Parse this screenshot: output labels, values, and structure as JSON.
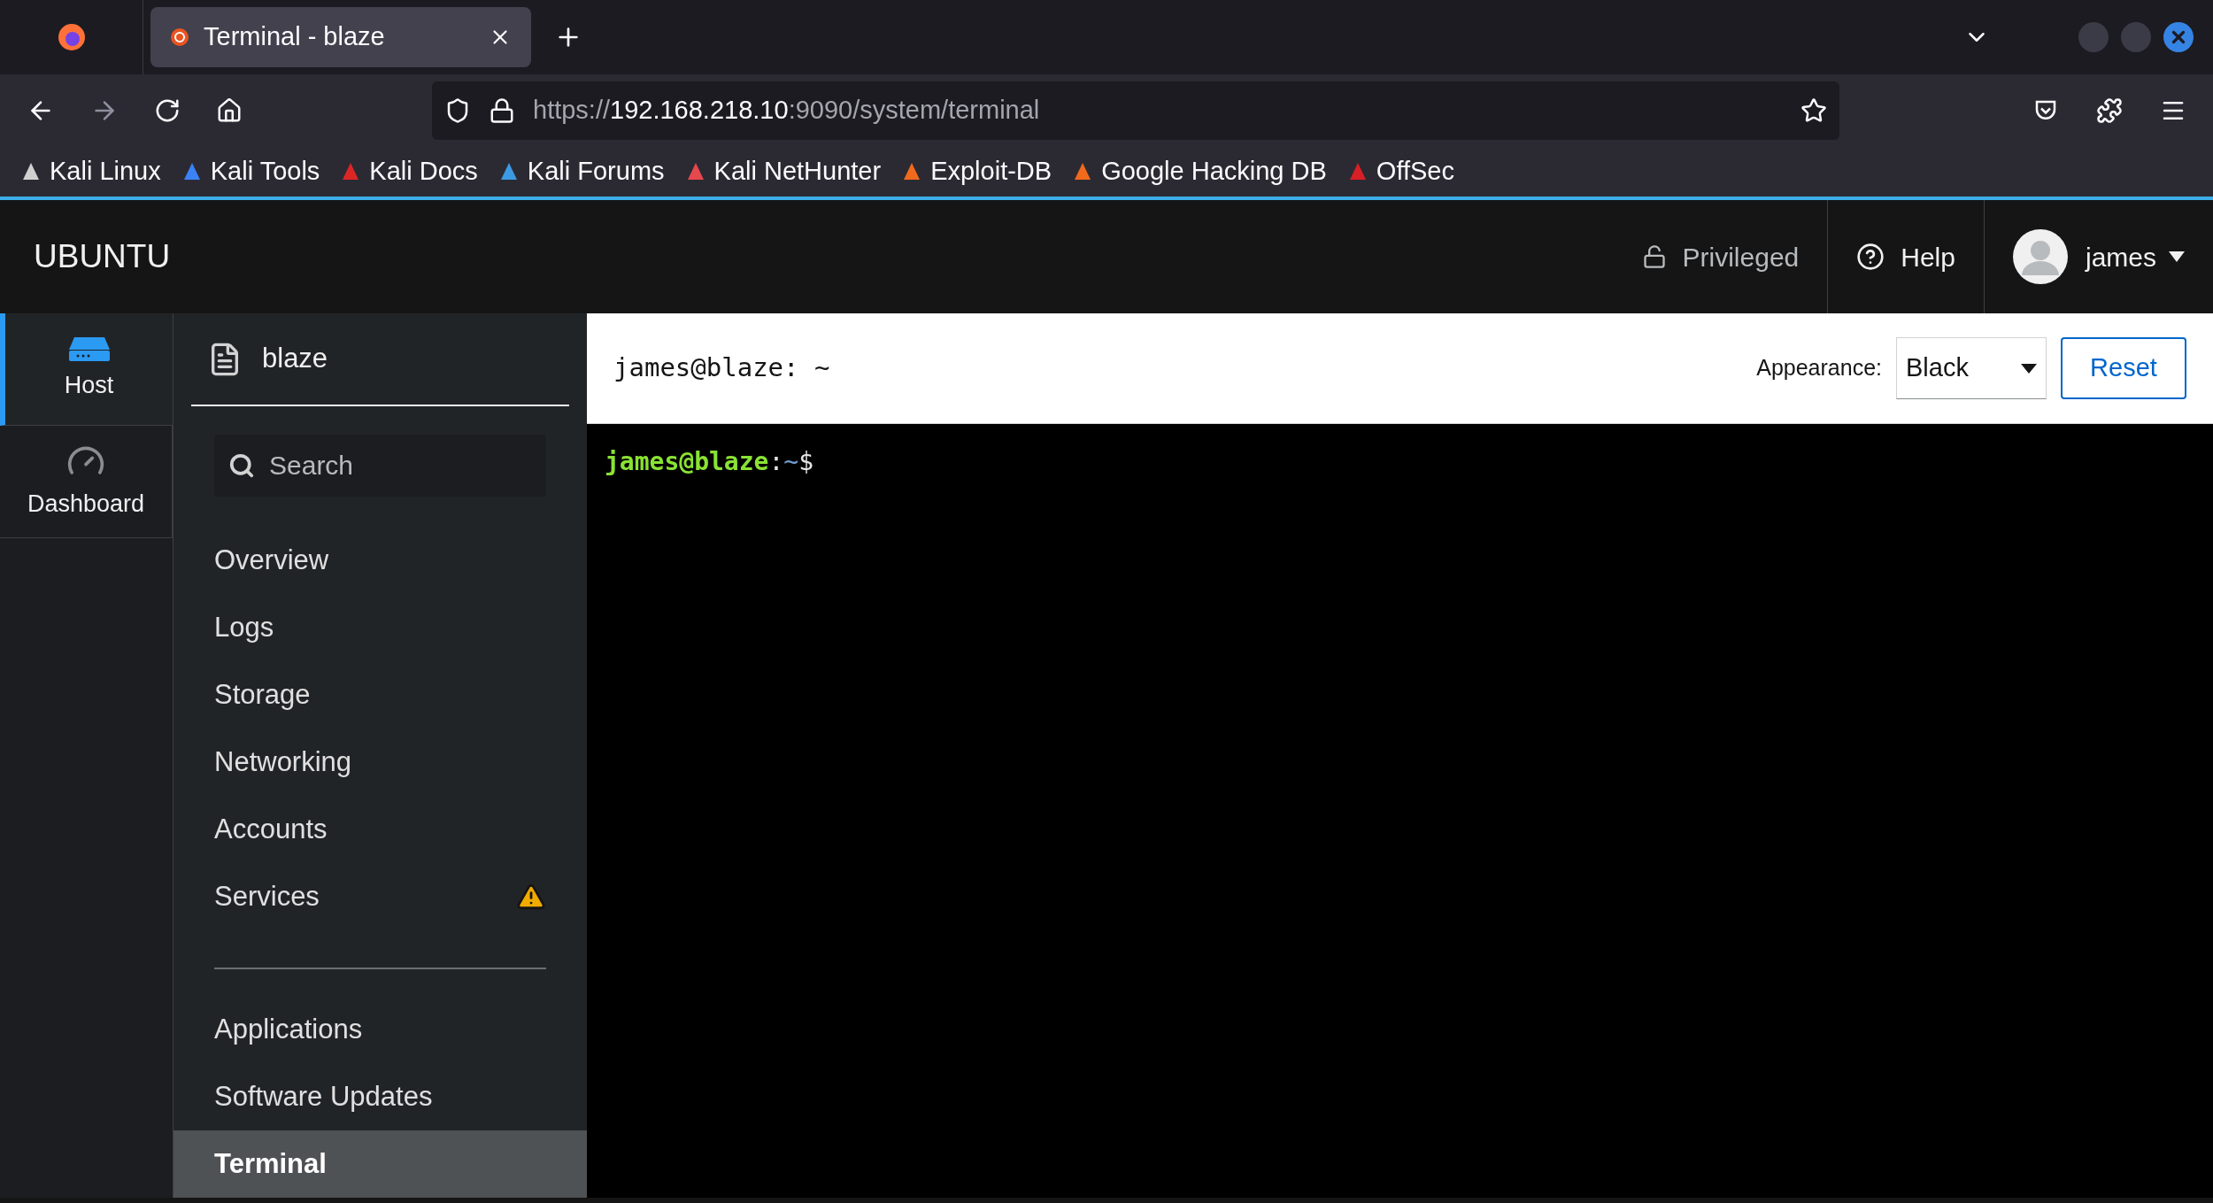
{
  "browser": {
    "tab": {
      "title": "Terminal - blaze",
      "selected": true
    },
    "url": {
      "scheme": "https://",
      "host": "192.168.218.10",
      "path": ":9090/system/terminal"
    },
    "bookmarks": [
      {
        "label": "Kali Linux",
        "color": "#d0d0d0"
      },
      {
        "label": "Kali Tools",
        "color": "#3b82f6"
      },
      {
        "label": "Kali Docs",
        "color": "#dc2626"
      },
      {
        "label": "Kali Forums",
        "color": "#3b9ae1"
      },
      {
        "label": "Kali NetHunter",
        "color": "#e5484d"
      },
      {
        "label": "Exploit-DB",
        "color": "#f06a1d"
      },
      {
        "label": "Google Hacking DB",
        "color": "#f06a1d"
      },
      {
        "label": "OffSec",
        "color": "#d91f26"
      }
    ]
  },
  "header": {
    "brand": "UBUNTU",
    "privileged": "Privileged",
    "help": "Help",
    "user": "james"
  },
  "rail": [
    {
      "label": "Host",
      "kind": "host",
      "selected": true
    },
    {
      "label": "Dashboard",
      "kind": "dashboard",
      "selected": false
    }
  ],
  "host": "blaze",
  "search": {
    "placeholder": "Search"
  },
  "nav_groups": [
    [
      {
        "label": "Overview",
        "selected": false,
        "warning": false
      },
      {
        "label": "Logs",
        "selected": false,
        "warning": false
      },
      {
        "label": "Storage",
        "selected": false,
        "warning": false
      },
      {
        "label": "Networking",
        "selected": false,
        "warning": false
      },
      {
        "label": "Accounts",
        "selected": false,
        "warning": false
      },
      {
        "label": "Services",
        "selected": false,
        "warning": true
      }
    ],
    [
      {
        "label": "Applications",
        "selected": false,
        "warning": false
      },
      {
        "label": "Software Updates",
        "selected": false,
        "warning": false
      },
      {
        "label": "Terminal",
        "selected": true,
        "warning": false
      }
    ]
  ],
  "terminal": {
    "title": "james@blaze: ~",
    "appearance_label": "Appearance:",
    "appearance": "Black",
    "reset": "Reset",
    "prompt": [
      {
        "text": "james@blaze",
        "kind": "user"
      },
      {
        "text": ":",
        "kind": "plain"
      },
      {
        "text": "~",
        "kind": "path"
      },
      {
        "text": "$",
        "kind": "plain"
      }
    ]
  }
}
